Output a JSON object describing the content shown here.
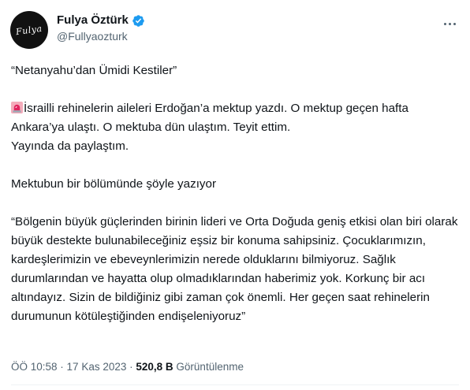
{
  "author": {
    "display_name": "Fulya Öztürk",
    "handle": "@Fullyaozturk",
    "avatar_text": "Fulya",
    "verified": true
  },
  "tweet": {
    "title_line": "“Netanyahu’dan Ümidi Kestiler”",
    "paragraph_1_icon": "rotating-light-icon",
    "paragraph_1": "İsrailli rehinelerin aileleri Erdoğan’a mektup yazdı. O mektup geçen hafta Ankara’ya ulaştı. O mektuba dün ulaştım. Teyit ettim.\nYayında da paylaştım.",
    "paragraph_2": "Mektubun bir bölümünde şöyle yazıyor",
    "paragraph_3": "“Bölgenin büyük güçlerinden birinin lideri ve Orta Doğuda geniş etkisi olan biri olarak büyük destekte bulunabileceğiniz eşsiz bir konuma sahipsiniz. Çocuklarımızın, kardeşlerimizin ve ebeveynlerimizin nerede olduklarını bilmiyoruz. Sağlık durumlarından ve hayatta olup olmadıklarından haberimiz yok. Korkunç bir acı altındayız. Sizin de bildiğiniz gibi zaman çok önemli. Her geçen saat rehinelerin durumunun kötüleştiğinden endişeleniyoruz”"
  },
  "meta": {
    "time": "ÖÖ 10:58",
    "separator": " · ",
    "date": "17 Kas 2023",
    "views_count": "520,8 B",
    "views_label": "Görüntülenme"
  },
  "colors": {
    "verified_blue": "#1d9bf0",
    "muted_text": "#536471",
    "main_text": "#0f1419",
    "siren_red": "#e0245e"
  }
}
